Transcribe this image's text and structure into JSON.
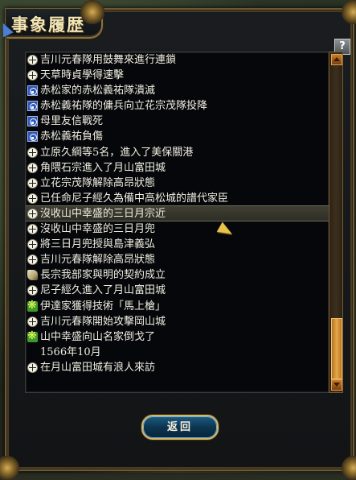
{
  "window": {
    "title": "事象履歴"
  },
  "help_label": "?",
  "return_label": "返回",
  "rows": [
    {
      "icon": "cross-icon",
      "text": "吉川元春隊用鼓舞來進行連鎖"
    },
    {
      "icon": "cross-icon",
      "text": "天草時貞學得速擊"
    },
    {
      "icon": "clan-icon",
      "text": "赤松家的赤松義祐隊潰滅"
    },
    {
      "icon": "clan-icon",
      "text": "赤松義祐隊的傭兵向立花宗茂隊投降"
    },
    {
      "icon": "clan-icon",
      "text": "母里友信戰死"
    },
    {
      "icon": "clan-icon",
      "text": "赤松義祐負傷"
    },
    {
      "icon": "cross-icon",
      "text": "立原久綱等5名，進入了美保關港"
    },
    {
      "icon": "cross-icon",
      "text": "角隈石宗進入了月山富田城"
    },
    {
      "icon": "cross-icon",
      "text": "立花宗茂隊解除高昂狀態"
    },
    {
      "icon": "cross-icon",
      "text": "已任命尼子經久為備中高松城的譜代家臣"
    },
    {
      "icon": "cross-icon",
      "text": "沒收山中幸盛的三日月宗近",
      "selected": true
    },
    {
      "icon": "cross-icon",
      "text": "沒收山中幸盛的三日月兜"
    },
    {
      "icon": "cross-icon",
      "text": "將三日月兜授與島津義弘"
    },
    {
      "icon": "cross-icon",
      "text": "吉川元春隊解除高昂狀態"
    },
    {
      "icon": "treaty-icon",
      "text": "長宗我部家與明的契約成立"
    },
    {
      "icon": "cross-icon",
      "text": "尼子經久進入了月山富田城"
    },
    {
      "icon": "tech-icon",
      "text": "伊達家獲得技術「馬上槍」"
    },
    {
      "icon": "cross-icon",
      "text": "吉川元春隊開始攻擊岡山城"
    },
    {
      "icon": "tech-icon",
      "text": "山中幸盛向山名家倒戈了"
    },
    {
      "icon": "",
      "text": "1566年10月",
      "header": true
    },
    {
      "icon": "cross-icon",
      "text": "在月山富田城有浪人來訪"
    }
  ],
  "colors": {
    "frame": "#6e5a36",
    "selected_row": "#3f3f33",
    "button": "#0c3550"
  }
}
